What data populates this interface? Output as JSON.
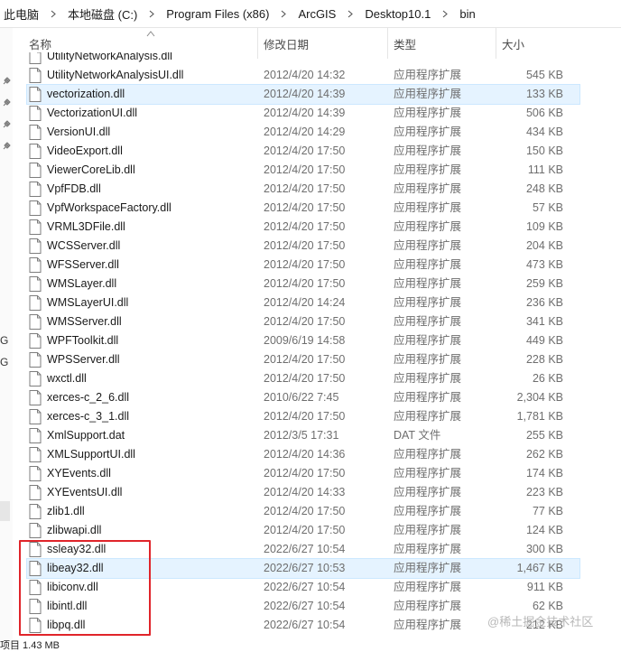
{
  "breadcrumb": [
    "此电脑",
    "本地磁盘 (C:)",
    "Program Files (x86)",
    "ArcGIS",
    "Desktop10.1",
    "bin"
  ],
  "columns": {
    "name": "名称",
    "date": "修改日期",
    "type": "类型",
    "size": "大小"
  },
  "partial_top_row": "UtilityNetworkAnalysis.dll",
  "files": [
    {
      "name": "UtilityNetworkAnalysisUI.dll",
      "date": "2012/4/20 14:32",
      "type": "应用程序扩展",
      "size": "545 KB"
    },
    {
      "name": "vectorization.dll",
      "date": "2012/4/20 14:39",
      "type": "应用程序扩展",
      "size": "133 KB"
    },
    {
      "name": "VectorizationUI.dll",
      "date": "2012/4/20 14:39",
      "type": "应用程序扩展",
      "size": "506 KB"
    },
    {
      "name": "VersionUI.dll",
      "date": "2012/4/20 14:29",
      "type": "应用程序扩展",
      "size": "434 KB"
    },
    {
      "name": "VideoExport.dll",
      "date": "2012/4/20 17:50",
      "type": "应用程序扩展",
      "size": "150 KB"
    },
    {
      "name": "ViewerCoreLib.dll",
      "date": "2012/4/20 17:50",
      "type": "应用程序扩展",
      "size": "111 KB"
    },
    {
      "name": "VpfFDB.dll",
      "date": "2012/4/20 17:50",
      "type": "应用程序扩展",
      "size": "248 KB"
    },
    {
      "name": "VpfWorkspaceFactory.dll",
      "date": "2012/4/20 17:50",
      "type": "应用程序扩展",
      "size": "57 KB"
    },
    {
      "name": "VRML3DFile.dll",
      "date": "2012/4/20 17:50",
      "type": "应用程序扩展",
      "size": "109 KB"
    },
    {
      "name": "WCSServer.dll",
      "date": "2012/4/20 17:50",
      "type": "应用程序扩展",
      "size": "204 KB"
    },
    {
      "name": "WFSServer.dll",
      "date": "2012/4/20 17:50",
      "type": "应用程序扩展",
      "size": "473 KB"
    },
    {
      "name": "WMSLayer.dll",
      "date": "2012/4/20 17:50",
      "type": "应用程序扩展",
      "size": "259 KB"
    },
    {
      "name": "WMSLayerUI.dll",
      "date": "2012/4/20 14:24",
      "type": "应用程序扩展",
      "size": "236 KB"
    },
    {
      "name": "WMSServer.dll",
      "date": "2012/4/20 17:50",
      "type": "应用程序扩展",
      "size": "341 KB"
    },
    {
      "name": "WPFToolkit.dll",
      "date": "2009/6/19 14:58",
      "type": "应用程序扩展",
      "size": "449 KB"
    },
    {
      "name": "WPSServer.dll",
      "date": "2012/4/20 17:50",
      "type": "应用程序扩展",
      "size": "228 KB"
    },
    {
      "name": "wxctl.dll",
      "date": "2012/4/20 17:50",
      "type": "应用程序扩展",
      "size": "26 KB"
    },
    {
      "name": "xerces-c_2_6.dll",
      "date": "2010/6/22 7:45",
      "type": "应用程序扩展",
      "size": "2,304 KB"
    },
    {
      "name": "xerces-c_3_1.dll",
      "date": "2012/4/20 17:50",
      "type": "应用程序扩展",
      "size": "1,781 KB"
    },
    {
      "name": "XmlSupport.dat",
      "date": "2012/3/5 17:31",
      "type": "DAT 文件",
      "size": "255 KB"
    },
    {
      "name": "XMLSupportUI.dll",
      "date": "2012/4/20 14:36",
      "type": "应用程序扩展",
      "size": "262 KB"
    },
    {
      "name": "XYEvents.dll",
      "date": "2012/4/20 17:50",
      "type": "应用程序扩展",
      "size": "174 KB"
    },
    {
      "name": "XYEventsUI.dll",
      "date": "2012/4/20 14:33",
      "type": "应用程序扩展",
      "size": "223 KB"
    },
    {
      "name": "zlib1.dll",
      "date": "2012/4/20 17:50",
      "type": "应用程序扩展",
      "size": "77 KB"
    },
    {
      "name": "zlibwapi.dll",
      "date": "2012/4/20 17:50",
      "type": "应用程序扩展",
      "size": "124 KB"
    },
    {
      "name": "ssleay32.dll",
      "date": "2022/6/27 10:54",
      "type": "应用程序扩展",
      "size": "300 KB"
    },
    {
      "name": "libeay32.dll",
      "date": "2022/6/27 10:53",
      "type": "应用程序扩展",
      "size": "1,467 KB"
    },
    {
      "name": "libiconv.dll",
      "date": "2022/6/27 10:54",
      "type": "应用程序扩展",
      "size": "911 KB"
    },
    {
      "name": "libintl.dll",
      "date": "2022/6/27 10:54",
      "type": "应用程序扩展",
      "size": "62 KB"
    },
    {
      "name": "libpq.dll",
      "date": "2022/6/27 10:54",
      "type": "应用程序扩展",
      "size": "212 KB"
    }
  ],
  "selected_files": [
    "vectorization.dll",
    "libeay32.dll"
  ],
  "side_strip_letters": [
    "G",
    "G"
  ],
  "status_text": "项目 1.43 MB",
  "watermark": "@稀土掘金技术社区",
  "colors": {
    "selection": "#e5f3ff",
    "highlight_border": "#e0242a"
  }
}
